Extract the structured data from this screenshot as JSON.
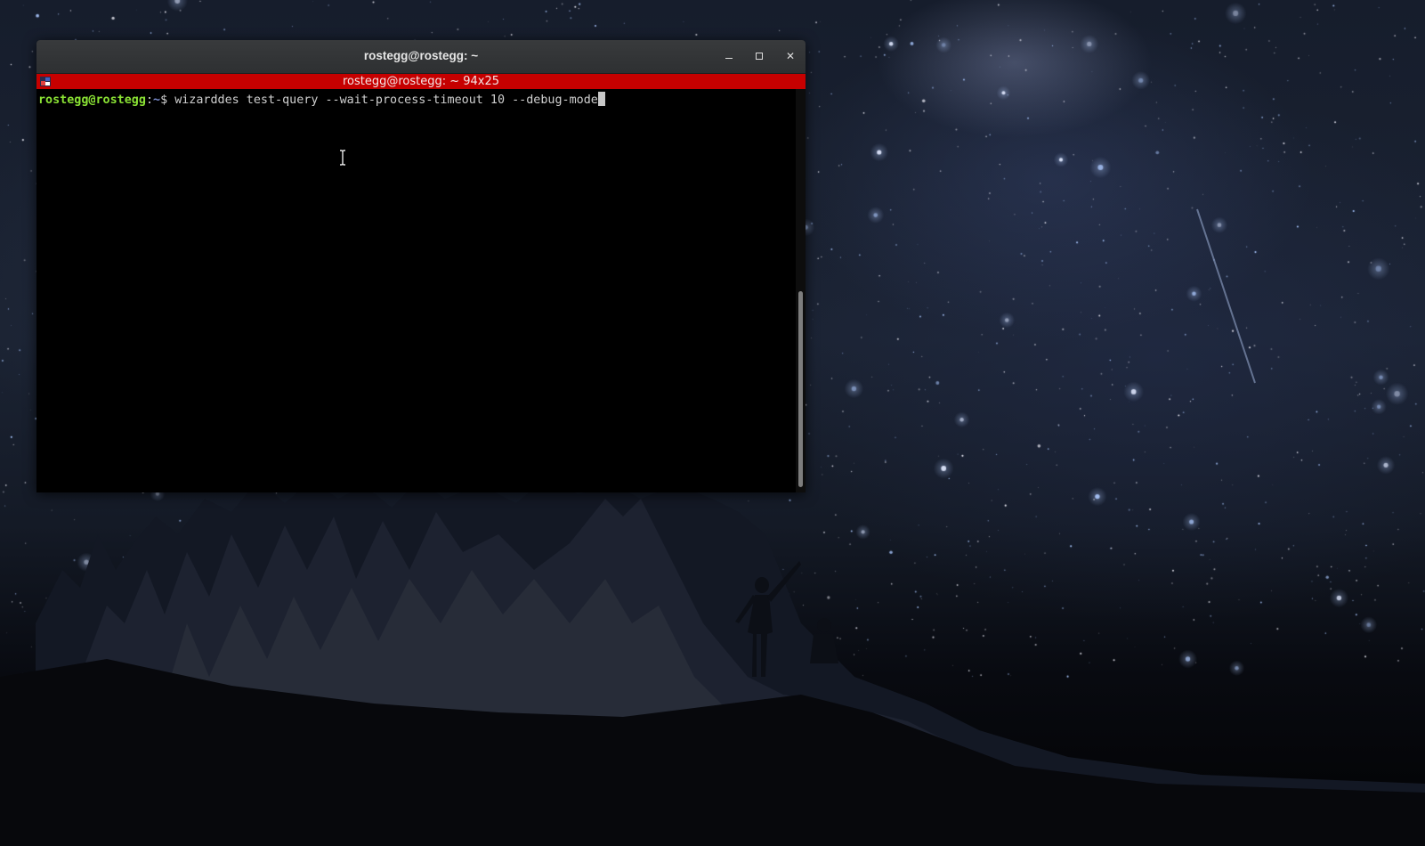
{
  "window": {
    "title": "rostegg@rostegg: ~",
    "minimize_glyph": "–",
    "maximize_glyph": "",
    "close_glyph": "✕"
  },
  "tmux": {
    "title": "rostegg@rostegg: ~ 94x25",
    "bar_color": "#c60000"
  },
  "terminal": {
    "prompt_user_host": "rostegg@rostegg",
    "prompt_separator": ":",
    "prompt_path": "~",
    "prompt_symbol": "$ ",
    "command": "wizarddes test-query --wait-process-timeout 10 --debug-mode",
    "colors": {
      "user_host": "#8ae234",
      "path": "#7b8dcf",
      "text": "#cfcfcf",
      "background": "#000000"
    }
  },
  "icons": {
    "window_minimize": "minimize-icon",
    "window_maximize": "maximize-icon",
    "window_close": "close-icon",
    "mouse_pointer": "text-cursor-icon",
    "tmux_app": "terminal-app-icon"
  }
}
